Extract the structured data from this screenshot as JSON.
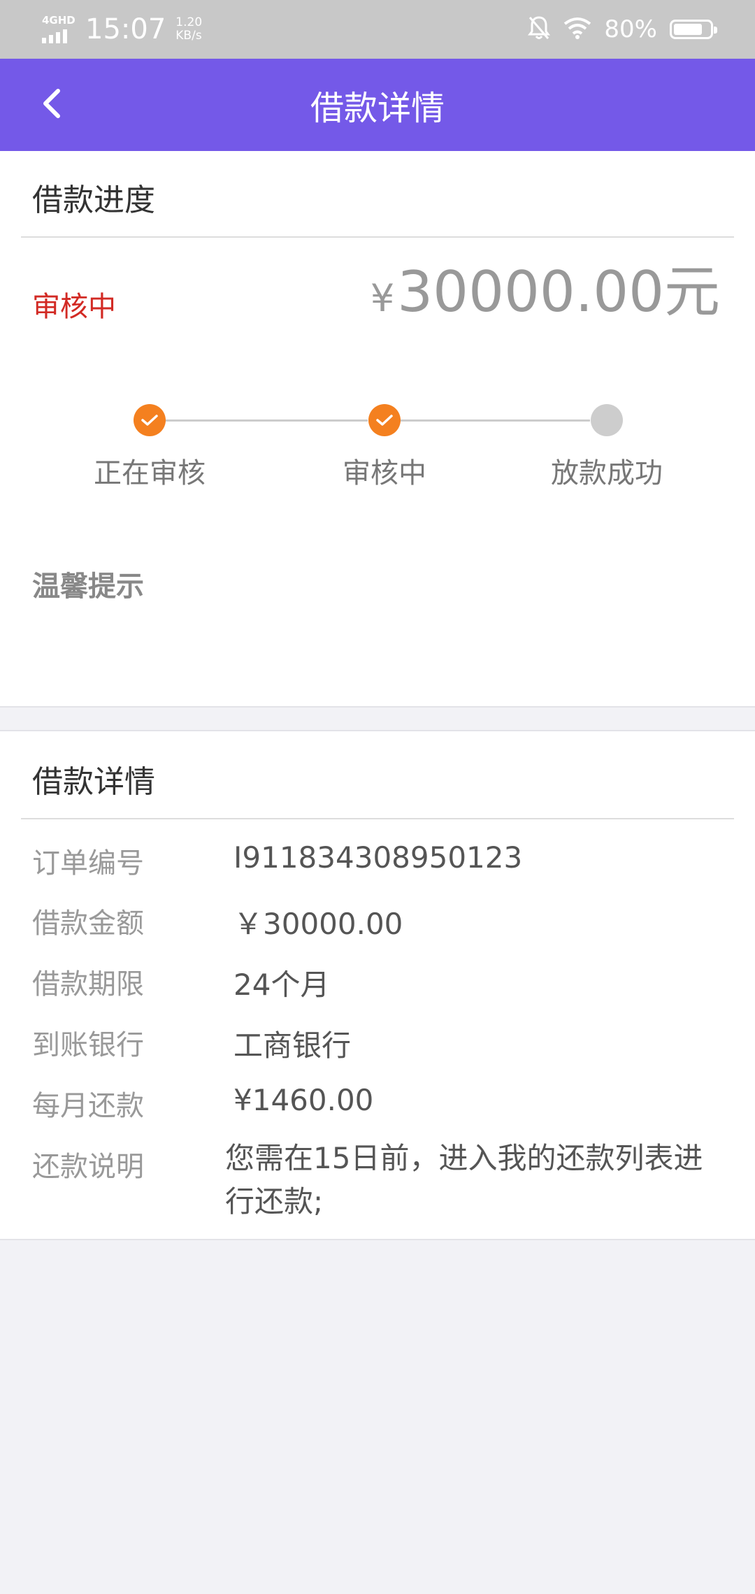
{
  "status_bar": {
    "network": "4GHD",
    "time": "15:07",
    "speed_value": "1.20",
    "speed_unit": "KB/s",
    "battery_percent": "80%",
    "battery_level": 0.8
  },
  "header": {
    "title": "借款详情"
  },
  "progress": {
    "section_title": "借款进度",
    "status": "审核中",
    "amount_symbol": "¥",
    "amount": "30000.00元",
    "steps": [
      {
        "label": "正在审核",
        "state": "done"
      },
      {
        "label": "审核中",
        "state": "done"
      },
      {
        "label": "放款成功",
        "state": "pending"
      }
    ],
    "tips_title": "温馨提示"
  },
  "details": {
    "section_title": "借款详情",
    "rows": [
      {
        "label": "订单编号",
        "value": "I911834308950123"
      },
      {
        "label": "借款金额",
        "value": "￥30000.00"
      },
      {
        "label": "借款期限",
        "value": "24个月"
      },
      {
        "label": "到账银行",
        "value": "工商银行"
      },
      {
        "label": "每月还款",
        "value": "¥1460.00"
      },
      {
        "label": "还款说明",
        "value": "您需在15日前，进入我的还款列表进行还款;"
      }
    ]
  },
  "colors": {
    "header": "#7459e8",
    "status_red": "#d22a24",
    "step_done": "#f4801f",
    "step_pending": "#cdcdcd",
    "background": "#f2f2f6"
  }
}
